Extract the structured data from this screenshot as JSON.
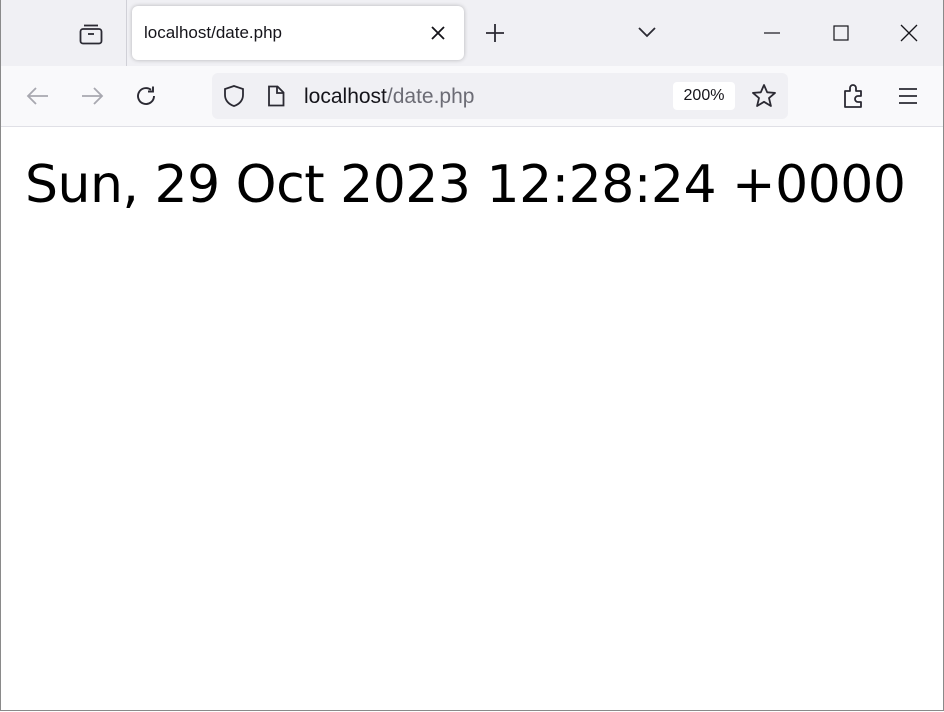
{
  "browser": {
    "tab": {
      "title": "localhost/date.php"
    },
    "address_bar": {
      "host": "localhost",
      "path": "/date.php",
      "zoom": "200%"
    },
    "icons": {
      "tab_manager": "tab-manager-icon",
      "close_tab": "close-icon",
      "new_tab": "plus-icon",
      "tab_list": "chevron-down-icon",
      "minimize": "minimize-icon",
      "maximize": "maximize-icon",
      "close_window": "close-icon",
      "back": "arrow-left-icon",
      "forward": "arrow-right-icon",
      "reload": "reload-icon",
      "tracking_protection": "shield-icon",
      "page_info": "page-icon",
      "bookmark": "star-icon",
      "extensions": "puzzle-icon",
      "menu": "hamburger-menu-icon"
    },
    "colors": {
      "tab_strip": "#f0f0f4",
      "nav_bar": "#f9f9fb",
      "url_field": "#f0f0f4",
      "url_path_text": "#6c6c75"
    }
  },
  "page": {
    "date_text": "Sun, 29 Oct 2023 12:28:24 +0000"
  }
}
